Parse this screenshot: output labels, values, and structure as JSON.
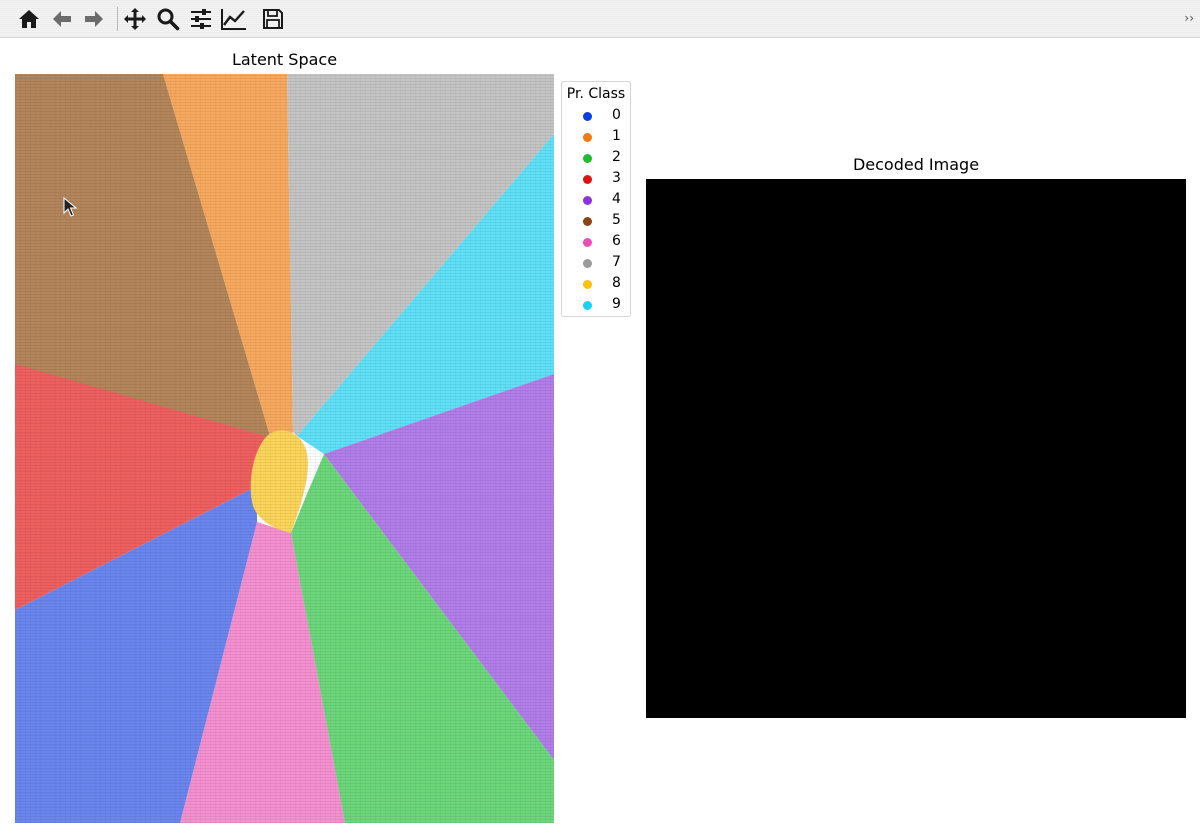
{
  "toolbar": {
    "buttons": [
      {
        "name": "home-icon",
        "label": "Home"
      },
      {
        "name": "back-icon",
        "label": "Back"
      },
      {
        "name": "forward-icon",
        "label": "Forward"
      },
      {
        "name": "pan-icon",
        "label": "Pan"
      },
      {
        "name": "zoom-icon",
        "label": "Zoom"
      },
      {
        "name": "subplots-icon",
        "label": "Subplots"
      },
      {
        "name": "customize-icon",
        "label": "Customize"
      },
      {
        "name": "save-icon",
        "label": "Save"
      }
    ],
    "overflow_label": "››"
  },
  "latent_plot": {
    "title": "Latent Space",
    "legend": {
      "title": "Pr. Class",
      "items": [
        {
          "label": "0",
          "color": "#0a3ee6"
        },
        {
          "label": "1",
          "color": "#f07a10"
        },
        {
          "label": "2",
          "color": "#22bb33"
        },
        {
          "label": "3",
          "color": "#dd1111"
        },
        {
          "label": "4",
          "color": "#8a35e0"
        },
        {
          "label": "5",
          "color": "#8b4513"
        },
        {
          "label": "6",
          "color": "#ea4fb8"
        },
        {
          "label": "7",
          "color": "#9a9a9a"
        },
        {
          "label": "8",
          "color": "#fbbf10"
        },
        {
          "label": "9",
          "color": "#19d0f5"
        }
      ]
    },
    "region_colors": {
      "0": "#6a86ee",
      "1": "#f6a95e",
      "2": "#6bd67a",
      "3": "#ee5f5f",
      "4": "#b17de9",
      "5": "#b3855a",
      "6": "#f48fd0",
      "7": "#c4c4c4",
      "8": "#fbd45a",
      "9": "#5fe0f6"
    }
  },
  "decoded_plot": {
    "title": "Decoded Image",
    "background": "#000000"
  }
}
